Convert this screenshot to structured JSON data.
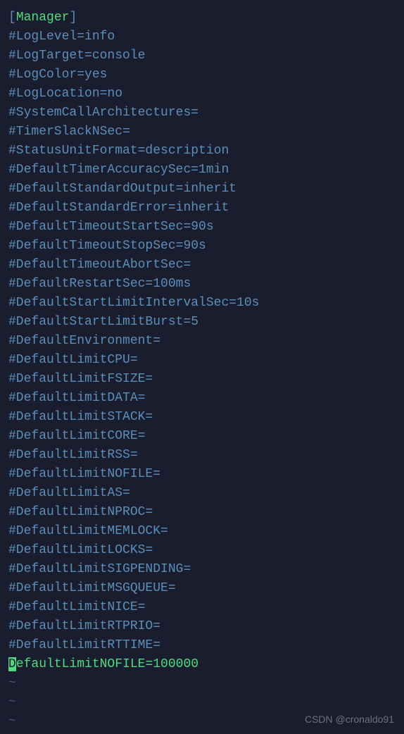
{
  "section": {
    "bracket_open": "[",
    "name": "Manager",
    "bracket_close": "]"
  },
  "lines": [
    "#LogLevel=info",
    "#LogTarget=console",
    "#LogColor=yes",
    "#LogLocation=no",
    "#SystemCallArchitectures=",
    "#TimerSlackNSec=",
    "#StatusUnitFormat=description",
    "#DefaultTimerAccuracySec=1min",
    "#DefaultStandardOutput=inherit",
    "#DefaultStandardError=inherit",
    "#DefaultTimeoutStartSec=90s",
    "#DefaultTimeoutStopSec=90s",
    "#DefaultTimeoutAbortSec=",
    "#DefaultRestartSec=100ms",
    "#DefaultStartLimitIntervalSec=10s",
    "#DefaultStartLimitBurst=5",
    "#DefaultEnvironment=",
    "#DefaultLimitCPU=",
    "#DefaultLimitFSIZE=",
    "#DefaultLimitDATA=",
    "#DefaultLimitSTACK=",
    "#DefaultLimitCORE=",
    "#DefaultLimitRSS=",
    "#DefaultLimitNOFILE=",
    "#DefaultLimitAS=",
    "#DefaultLimitNPROC=",
    "#DefaultLimitMEMLOCK=",
    "#DefaultLimitLOCKS=",
    "#DefaultLimitSIGPENDING=",
    "#DefaultLimitMSGQUEUE=",
    "#DefaultLimitNICE=",
    "#DefaultLimitRTPRIO=",
    "#DefaultLimitRTTIME="
  ],
  "active_line": {
    "cursor_char": "D",
    "rest": "efaultLimitNOFILE=100000"
  },
  "tildes": [
    "~",
    "~",
    "~"
  ],
  "watermark": "CSDN @cronaldo91"
}
